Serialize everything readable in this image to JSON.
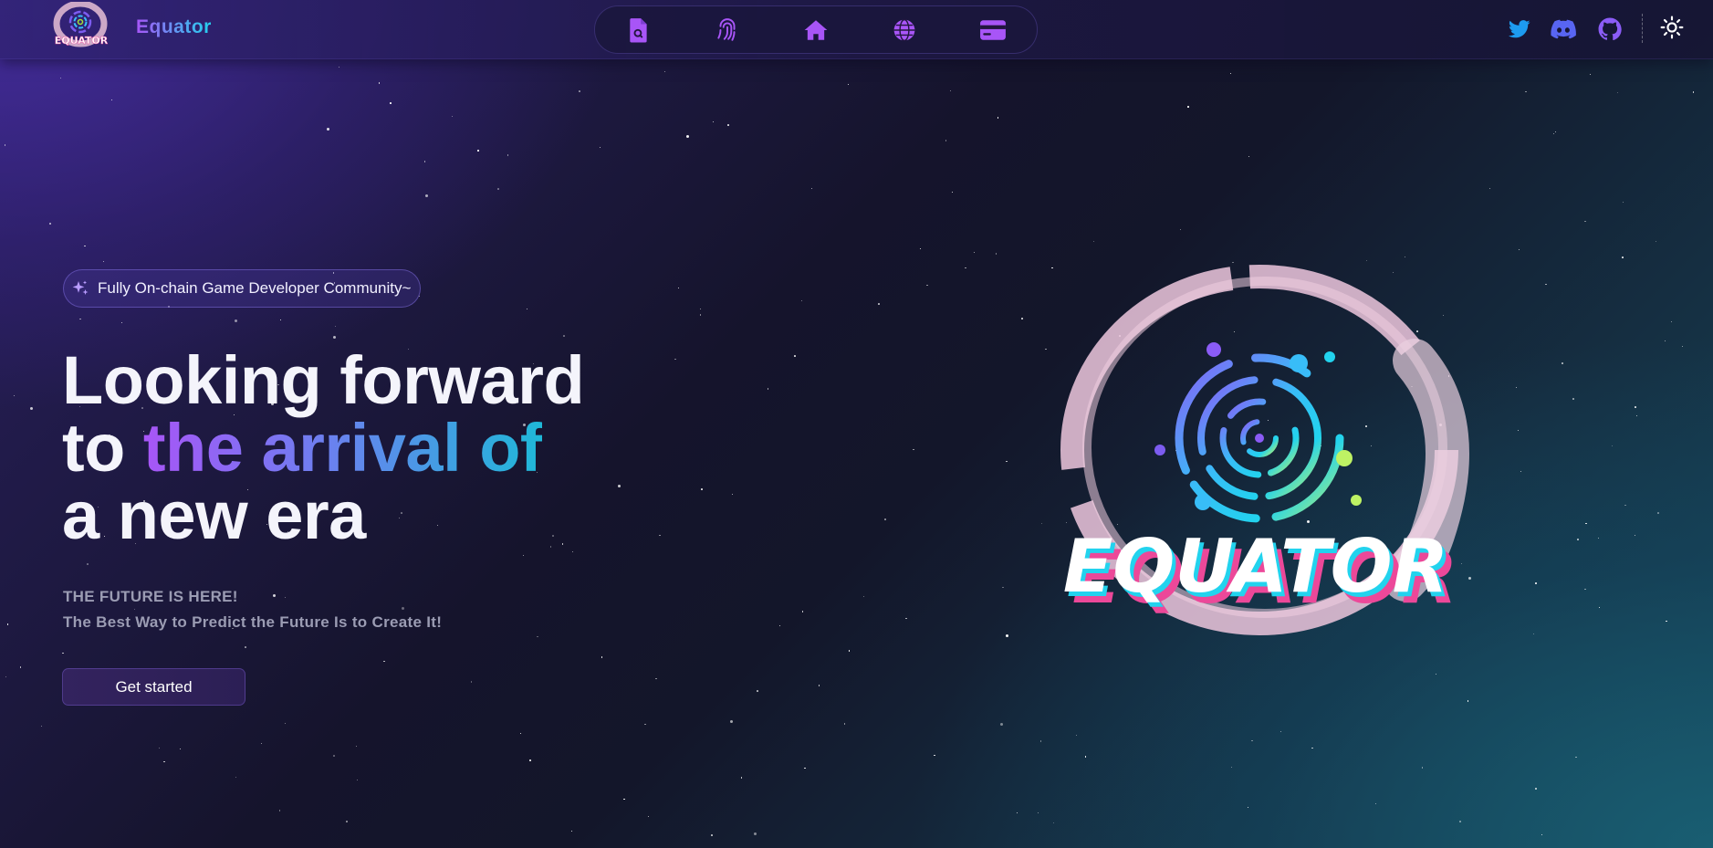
{
  "header": {
    "brand": "Equator",
    "logo_text": "EQUATOR",
    "nav_icons": [
      "file-search-icon",
      "fingerprint-icon",
      "home-icon",
      "globe-icon",
      "credit-card-icon"
    ],
    "social_icons": [
      "twitter-icon",
      "discord-icon",
      "github-icon"
    ],
    "theme_toggle_icon": "sun-icon"
  },
  "hero": {
    "badge_text": "Fully On-chain Game Developer Community~",
    "headline": {
      "line1": "Looking forward",
      "line2_prefix": "to ",
      "line2_gradient": "the arrival of",
      "line3": "a new era"
    },
    "tagline_line1": "THE FUTURE IS HERE!",
    "tagline_line2": "The Best Way to Predict the Future Is to Create It!",
    "cta_label": "Get started",
    "logo_text": "EQUATOR"
  },
  "colors": {
    "accent_purple": "#a855f7",
    "accent_cyan": "#22d3ee",
    "twitter": "#1d9bf0",
    "discord": "#5865f2",
    "github": "#8b5cf6"
  }
}
